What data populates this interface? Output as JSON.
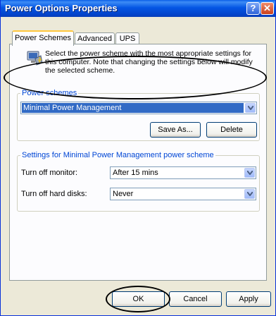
{
  "window": {
    "title": "Power Options Properties",
    "help_glyph": "?",
    "close_glyph": "✕"
  },
  "tabs": [
    {
      "label": "Power Schemes",
      "active": true
    },
    {
      "label": "Advanced",
      "active": false
    },
    {
      "label": "UPS",
      "active": false
    }
  ],
  "info": {
    "text": "Select the power scheme with the most appropriate settings for this computer. Note that changing the settings below will modify the selected scheme.",
    "icon": "power-options-icon"
  },
  "power_schemes": {
    "group_label": "Power schemes",
    "selected": "Minimal Power Management",
    "save_as_label": "Save As...",
    "delete_label": "Delete"
  },
  "settings": {
    "group_label": "Settings for Minimal Power Management power scheme",
    "monitor_label": "Turn off monitor:",
    "monitor_value": "After 15 mins",
    "disks_label": "Turn off hard disks:",
    "disks_value": "Never"
  },
  "footer": {
    "ok_label": "OK",
    "cancel_label": "Cancel",
    "apply_label": "Apply"
  },
  "colors": {
    "titlebar": "#0456e4",
    "group_label": "#0046d5",
    "selection": "#316ac5",
    "dialog_bg": "#ece9d8"
  }
}
